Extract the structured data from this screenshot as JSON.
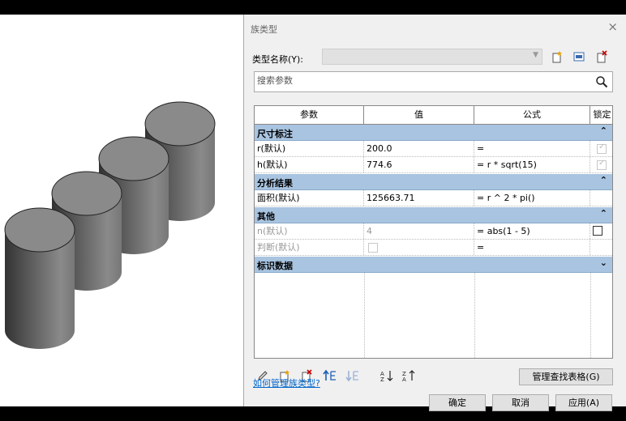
{
  "dialog": {
    "title": "族类型",
    "close_glyph": "×",
    "type_name_label": "类型名称(Y):",
    "type_name_value": "",
    "search_placeholder": "搜索参数",
    "columns": [
      "参数",
      "值",
      "公式",
      "锁定"
    ],
    "groups": [
      {
        "label": "尺寸标注",
        "chevron": "⌃",
        "rows": [
          {
            "param": "r(默认)",
            "value": "200.0",
            "formula": "=",
            "lock": "checked-disabled"
          },
          {
            "param": "h(默认)",
            "value": "774.6",
            "formula": "= r * sqrt(15)",
            "lock": "checked-disabled"
          }
        ]
      },
      {
        "label": "分析结果",
        "chevron": "⌃",
        "rows": [
          {
            "param": "面积(默认)",
            "value": "125663.71",
            "formula": "= r ^ 2 * pi()",
            "lock": "none"
          }
        ]
      },
      {
        "label": "其他",
        "chevron": "⌃",
        "rows": [
          {
            "param": "n(默认)",
            "value": "4",
            "formula": "= abs(1 - 5)",
            "lock": "unchecked"
          },
          {
            "param": "判断(默认)",
            "value": "",
            "formula": "=",
            "lock": "none"
          }
        ]
      },
      {
        "label": "标识数据",
        "chevron": "⌄",
        "rows": []
      }
    ],
    "manage_lookup_label": "管理查找表格(G)",
    "help_link": "如何管理族类型?",
    "ok_label": "确定",
    "cancel_label": "取消",
    "apply_label": "应用(A)"
  },
  "icons": {
    "toolbar": [
      "new-type-icon",
      "rename-type-icon",
      "delete-type-icon"
    ],
    "bottom_tools": [
      "edit-parameter-icon",
      "new-parameter-icon",
      "delete-parameter-icon",
      "move-up-icon",
      "move-down-icon",
      "sort-ascending-icon",
      "sort-descending-icon"
    ]
  },
  "colors": {
    "group_header": "#a8c4e0",
    "link": "#0066cc",
    "cylinder_top": "#8a8a8a"
  }
}
